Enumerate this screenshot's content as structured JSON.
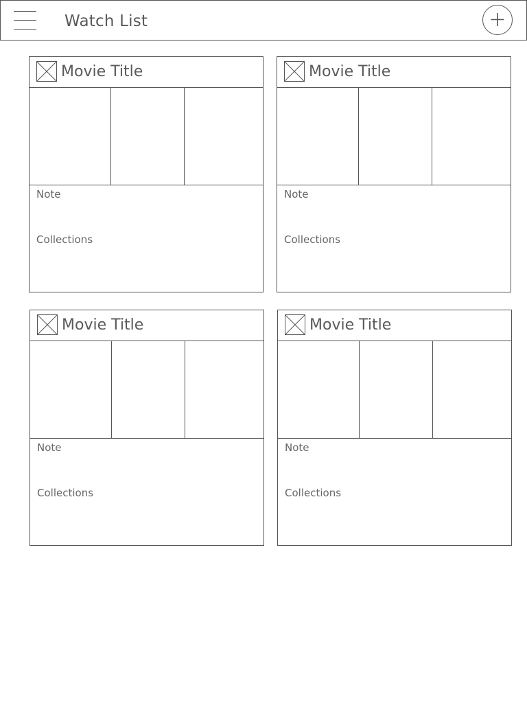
{
  "header": {
    "title": "Watch List",
    "menu_icon": "hamburger-menu-icon",
    "add_icon": "plus-icon"
  },
  "cards": [
    {
      "title": "Movie Title",
      "note_label": "Note",
      "collections_label": "Collections",
      "thumbnail_icon": "image-placeholder-icon"
    },
    {
      "title": "Movie Title",
      "note_label": "Note",
      "collections_label": "Collections",
      "thumbnail_icon": "image-placeholder-icon"
    },
    {
      "title": "Movie Title",
      "note_label": "Note",
      "collections_label": "Collections",
      "thumbnail_icon": "image-placeholder-icon"
    },
    {
      "title": "Movie Title",
      "note_label": "Note",
      "collections_label": "Collections",
      "thumbnail_icon": "image-placeholder-icon"
    }
  ],
  "colors": {
    "stroke": "#555555",
    "text": "#5a5a5a",
    "background": "#ffffff"
  }
}
